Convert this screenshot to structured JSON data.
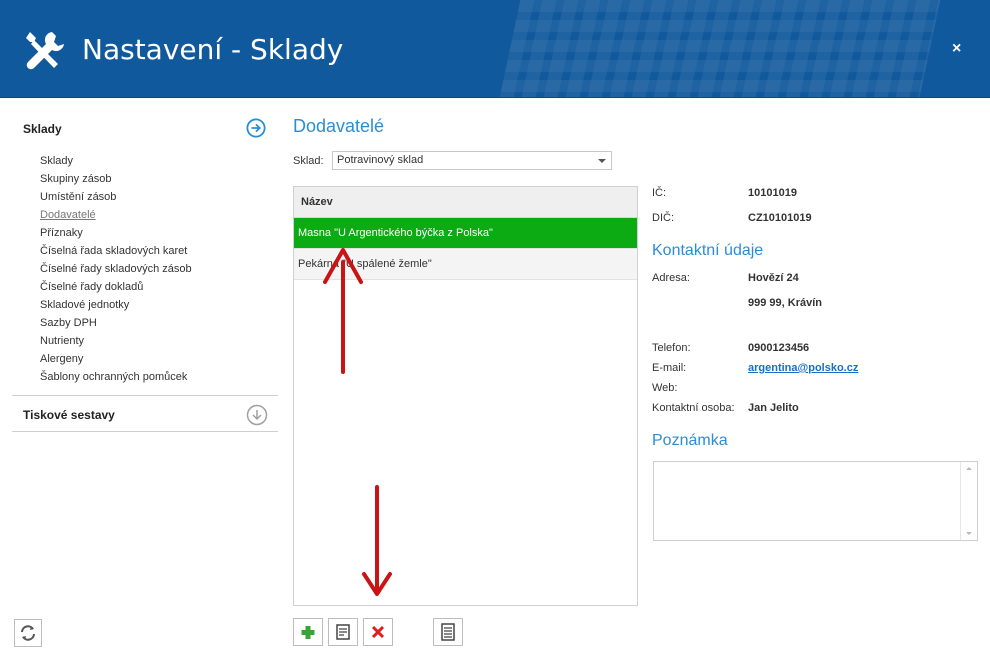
{
  "window": {
    "title": "Nastavení - Sklady",
    "close_label": "×"
  },
  "sidebar": {
    "sections": [
      {
        "label": "Sklady",
        "expanded": true
      },
      {
        "label": "Tiskové sestavy",
        "expanded": false
      }
    ],
    "items": [
      {
        "label": "Sklady"
      },
      {
        "label": "Skupiny zásob"
      },
      {
        "label": "Umístění zásob"
      },
      {
        "label": "Dodavatelé",
        "active": true
      },
      {
        "label": "Příznaky"
      },
      {
        "label": "Číselná řada skladových karet"
      },
      {
        "label": "Číselné řady skladových zásob"
      },
      {
        "label": "Číselné řady dokladů"
      },
      {
        "label": "Skladové jednotky"
      },
      {
        "label": "Sazby DPH"
      },
      {
        "label": "Nutrienty"
      },
      {
        "label": "Alergeny"
      },
      {
        "label": "Šablony ochranných pomůcek"
      }
    ]
  },
  "main": {
    "title": "Dodavatelé",
    "sklad_label": "Sklad:",
    "sklad_value": "Potravinový sklad",
    "grid": {
      "header": "Název",
      "rows": [
        {
          "name": "Masna \"U Argentického býčka z Polska\"",
          "selected": true
        },
        {
          "name": "Pekárna \"U spálené žemle\"",
          "selected": false
        }
      ]
    }
  },
  "detail": {
    "ic_label": "IČ:",
    "ic_value": "10101019",
    "dic_label": "DIČ:",
    "dic_value": "CZ10101019",
    "contact_head": "Kontaktní údaje",
    "address_label": "Adresa:",
    "address_line1": "Hovězí 24",
    "address_line2": "999 99, Krávín",
    "phone_label": "Telefon:",
    "phone_value": "0900123456",
    "email_label": "E-mail:",
    "email_value": "argentina@polsko.cz",
    "web_label": "Web:",
    "person_label": "Kontaktní osoba:",
    "person_value": "Jan Jelito",
    "note_head": "Poznámka"
  },
  "colors": {
    "header": "#10599c",
    "accent": "#2b8dd6",
    "selected_row": "#0cab13",
    "annotation_arrow": "#c81414"
  }
}
